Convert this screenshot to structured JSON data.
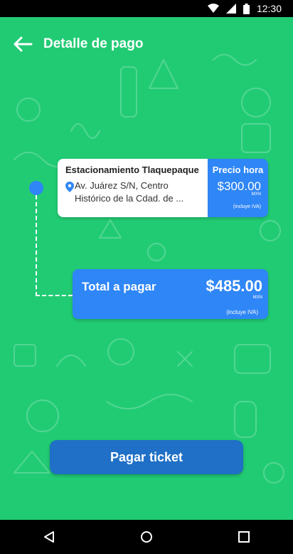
{
  "status_bar": {
    "time": "12:30"
  },
  "app_bar": {
    "title": "Detalle de pago"
  },
  "parking": {
    "name": "Estacionamiento Tlaquepaque",
    "address": "Av. Juárez S/N, Centro Histórico de la Cdad. de ...",
    "price_label": "Precio hora",
    "price": "$300.00",
    "currency": "MXN",
    "tax_note": "(incluye IVA)"
  },
  "total": {
    "label": "Total a pagar",
    "amount": "$485.00",
    "currency": "MXN",
    "tax_note": "(incluye IVA)"
  },
  "pay_button": {
    "label": "Pagar ticket"
  },
  "colors": {
    "background": "#21cb74",
    "accent": "#2f86f6",
    "button": "#1f70c6"
  }
}
